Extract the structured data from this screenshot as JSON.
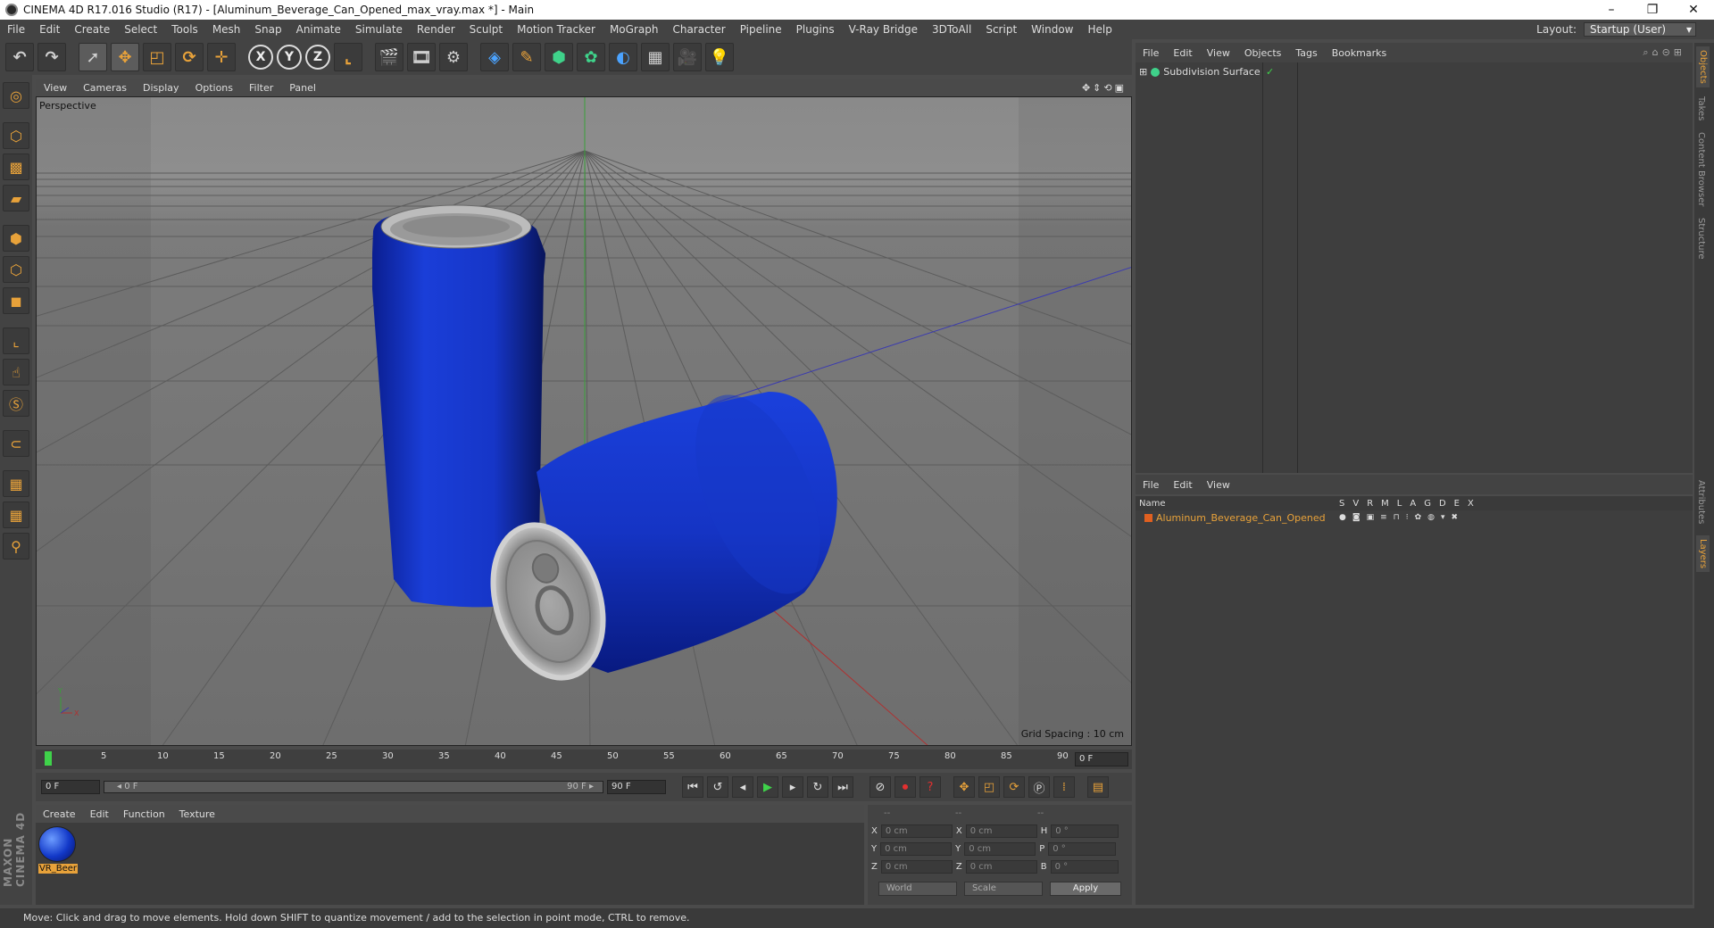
{
  "window": {
    "title": "CINEMA 4D R17.016 Studio (R17) - [Aluminum_Beverage_Can_Opened_max_vray.max *] - Main",
    "controls": [
      "–",
      "❐",
      "✕"
    ]
  },
  "menubar": {
    "items": [
      "File",
      "Edit",
      "Create",
      "Select",
      "Tools",
      "Mesh",
      "Snap",
      "Animate",
      "Simulate",
      "Render",
      "Sculpt",
      "Motion Tracker",
      "MoGraph",
      "Character",
      "Pipeline",
      "Plugins",
      "V-Ray Bridge",
      "3DToAll",
      "Script",
      "Window",
      "Help"
    ],
    "layout_label": "Layout:",
    "layout_value": "Startup (User)"
  },
  "toolbar": {
    "axis_labels": [
      "X",
      "Y",
      "Z"
    ]
  },
  "viewport": {
    "menu": [
      "View",
      "Cameras",
      "Display",
      "Options",
      "Filter",
      "Panel"
    ],
    "nav_icons": "✥⇕⟲▣",
    "camera_label": "Perspective",
    "grid_spacing": "Grid Spacing : 10 cm",
    "axis_y": "Y",
    "axis_x": "X"
  },
  "timeline": {
    "ticks": [
      "0",
      "5",
      "10",
      "15",
      "20",
      "25",
      "30",
      "35",
      "40",
      "45",
      "50",
      "55",
      "60",
      "65",
      "70",
      "75",
      "80",
      "85",
      "90"
    ],
    "end_frame_field": "0 F"
  },
  "transport": {
    "start_field": "0 F",
    "slider_left": "◂ 0 F",
    "slider_right": "90 F ▸",
    "end_field": "90 F"
  },
  "material_manager": {
    "menu": [
      "Create",
      "Edit",
      "Function",
      "Texture"
    ],
    "materials": [
      {
        "name": "VR_Beer"
      }
    ]
  },
  "coordinates": {
    "headers": [
      "--",
      "--",
      "--"
    ],
    "rows": [
      {
        "a": "X",
        "v1": "0 cm",
        "b": "X",
        "v2": "0 cm",
        "c": "H",
        "v3": "0 °"
      },
      {
        "a": "Y",
        "v1": "0 cm",
        "b": "Y",
        "v2": "0 cm",
        "c": "P",
        "v3": "0 °"
      },
      {
        "a": "Z",
        "v1": "0 cm",
        "b": "Z",
        "v2": "0 cm",
        "c": "B",
        "v3": "0 °"
      }
    ],
    "mode1": "World",
    "mode2": "Scale",
    "apply": "Apply"
  },
  "objects_panel": {
    "menu": [
      "File",
      "Edit",
      "View",
      "Objects",
      "Tags",
      "Bookmarks"
    ],
    "objects": [
      {
        "name": "Subdivision Surface",
        "tag": "✓"
      }
    ]
  },
  "layers_panel": {
    "menu": [
      "File",
      "Edit",
      "View"
    ],
    "header_name": "Name",
    "header_cols": [
      "S",
      "V",
      "R",
      "M",
      "L",
      "A",
      "G",
      "D",
      "E",
      "X"
    ],
    "layers": [
      {
        "name": "Aluminum_Beverage_Can_Opened"
      }
    ]
  },
  "side_tabs": [
    "Objects",
    "Takes",
    "Content Browser",
    "Structure",
    "Attributes",
    "Layers"
  ],
  "status": "Move: Click and drag to move elements. Hold down SHIFT to quantize movement / add to the selection in point mode, CTRL to remove.",
  "branding": "MAXON CINEMA 4D",
  "colors": {
    "accent": "#e8a23a",
    "can_blue": "#1a3ed8",
    "viewport_bg": "#8b8b8b"
  }
}
